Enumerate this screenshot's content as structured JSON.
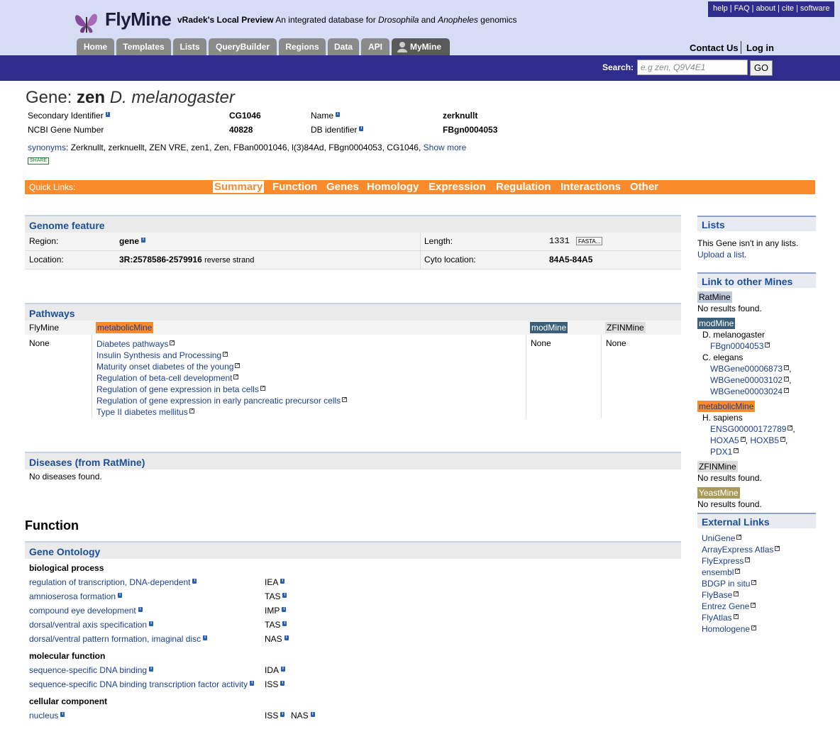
{
  "header": {
    "brand": "FlyMine",
    "preview": "vRadek's Local Preview",
    "tagline_pre": "An integrated database for ",
    "tagline_it1": "Drosophila",
    "tagline_mid": " and ",
    "tagline_it2": "Anopheles",
    "tagline_post": " genomics",
    "top_links": [
      "help",
      "FAQ",
      "about",
      "cite",
      "software"
    ],
    "tabs": [
      "Home",
      "Templates",
      "Lists",
      "QueryBuilder",
      "Regions",
      "Data",
      "API",
      "MyMine"
    ],
    "contact": "Contact Us",
    "login": "Log in",
    "search_label": "Search:",
    "search_placeholder": "e.g zen, Q9V4E1",
    "go": "GO"
  },
  "gene": {
    "title_prefix": "Gene: ",
    "symbol": "zen",
    "organism": "D. melanogaster",
    "fields": [
      {
        "label": "Secondary Identifier",
        "value": "CG1046"
      },
      {
        "label": "NCBI Gene Number",
        "value": "40828"
      },
      {
        "label": "Name",
        "value": "zerknullt"
      },
      {
        "label": "DB identifier",
        "value": "FBgn0004053"
      }
    ],
    "synonyms_label": "synonyms",
    "synonyms": ": Zerknullt, zerknuellt, ZEN VRE, zen1, Zen, FBan0001046, l(3)84Ad, FBgn0004053, CG1046,",
    "show_more": "Show more",
    "share": "SHARE"
  },
  "quicklinks": {
    "label": "Quick Links:",
    "items": [
      "Summary",
      "Function",
      "Genes",
      "Homology",
      "Expression",
      "Regulation",
      "Interactions",
      "Other"
    ]
  },
  "genome": {
    "title": "Genome feature",
    "region_label": "Region:",
    "region": "gene",
    "length_label": "Length:",
    "length": "1331",
    "fasta": "FASTA...",
    "location_label": "Location:",
    "location": "3R:2578586-2579916",
    "strand": "reverse strand",
    "cyto_label": "Cyto location:",
    "cyto": "84A5-84A5"
  },
  "pathways": {
    "title": "Pathways",
    "cols": [
      "FlyMine",
      "metabolicMine",
      "modMine",
      "ZFINMine"
    ],
    "none": "None",
    "items": [
      "Diabetes pathways",
      "Insulin Synthesis and Processing",
      "Maturity onset diabetes of the young",
      "Regulation of beta-cell development",
      "Regulation of gene expression in beta cells",
      "Regulation of gene expression in early pancreatic precursor cells",
      "Type II diabetes mellitus"
    ]
  },
  "diseases": {
    "title": "Diseases (from RatMine)",
    "text": "No diseases found."
  },
  "function": {
    "title": "Function",
    "go_title": "Gene Ontology",
    "groups": [
      {
        "name": "biological process",
        "terms": [
          {
            "term": "regulation of transcription, DNA-dependent",
            "code": "IEA"
          },
          {
            "term": "amnioserosa formation",
            "code": "TAS"
          },
          {
            "term": "compound eye development",
            "code": "IMP"
          },
          {
            "term": "dorsal/ventral axis specification",
            "code": "TAS"
          },
          {
            "term": "dorsal/ventral pattern formation, imaginal disc",
            "code": "NAS"
          }
        ]
      },
      {
        "name": "molecular function",
        "terms": [
          {
            "term": "sequence-specific DNA binding",
            "code": "IDA"
          },
          {
            "term": "sequence-specific DNA binding transcription factor activity",
            "code": "ISS"
          }
        ]
      },
      {
        "name": "cellular component",
        "terms": [
          {
            "term": "nucleus",
            "code": "ISS",
            "code2": "NAS"
          }
        ]
      }
    ]
  },
  "sidebar": {
    "lists_title": "Lists",
    "lists_text": "This Gene isn't in any lists.",
    "upload": "Upload a list.",
    "mines_title": "Link to other Mines",
    "ratmine": "RatMine",
    "no_results": "No results found.",
    "modmine": "modMine",
    "dmel": "D. melanogaster",
    "fbgn": "FBgn0004053",
    "celegans": "C. elegans",
    "wb1": "WBGene00006873",
    "wb2": "WBGene00003102",
    "wb3": "WBGene00003024",
    "metabolicmine": "metabolicMine",
    "hsap": "H. sapiens",
    "ensg": "ENSG00000172789",
    "hoxa5": "HOXA5",
    "hoxb5": "HOXB5",
    "pdx1": "PDX1",
    "zfinmine": "ZFINMine",
    "yeastmine": "YeastMine",
    "ext_title": "External Links",
    "ext": [
      "UniGene",
      "ArrayExpress Atlas",
      "FlyExpress",
      "ensembl",
      "BDGP in situ",
      "FlyBase",
      "Entrez Gene",
      "FlyAtlas",
      "Homologene"
    ]
  },
  "colors": {
    "accent": "#fa8b2c",
    "nav": "#2e2c8c",
    "header_bg": "#d5dcf4",
    "link": "#1c3f94",
    "modmine": "#3a5f7a",
    "yeastmine": "#a99a5a"
  }
}
